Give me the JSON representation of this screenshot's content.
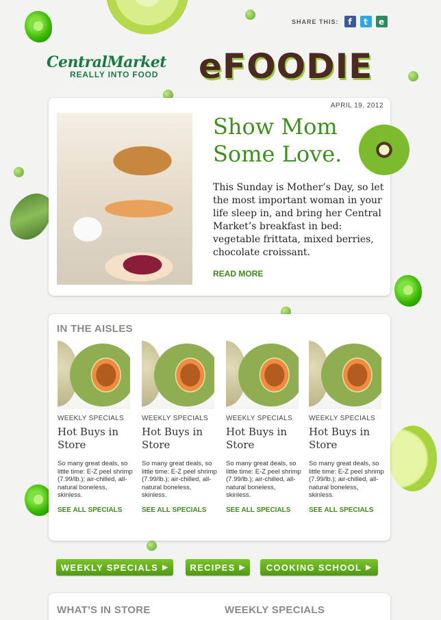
{
  "header": {
    "share_label": "SHARE THIS:",
    "share_icons": [
      "facebook-icon",
      "twitter-icon",
      "email-icon"
    ],
    "share_glyphs": {
      "facebook": "f",
      "twitter": "t",
      "email": "e"
    },
    "brand_name": "CentralMarket",
    "brand_tagline": "REALLY INTO FOOD",
    "newsletter_title": "eFOODIE"
  },
  "hero": {
    "date": "APRIL 19, 2012",
    "title": "Show Mom Some Love.",
    "body": "This Sunday is Mother’s Day, so let the most important woman in your life sleep in, and bring her Central Market’s breakfast in bed: vegetable frittata, mixed berries, chocolate croissant.",
    "link": "READ MORE"
  },
  "aisles": {
    "heading": "IN THE AISLES",
    "items": [
      {
        "kicker": "WEEKLY SPECIALS",
        "title": "Hot Buys in Store",
        "body": "So many great deals, so little time: E-Z peel shrimp (7.99/lb.); air-chilled, all-natural boneless, skinless.",
        "link": "SEE ALL SPECIALS"
      },
      {
        "kicker": "WEEKLY SPECIALS",
        "title": "Hot Buys in Store",
        "body": "So many great deals, so little time: E-Z peel shrimp (7.99/lb.); air-chilled, all-natural boneless, skinless.",
        "link": "SEE ALL SPECIALS"
      },
      {
        "kicker": "WEEKLY SPECIALS",
        "title": "Hot Buys in Store",
        "body": "So many great deals, so little time: E-Z peel shrimp (7.99/lb.); air-chilled, all-natural boneless, skinless.",
        "link": "SEE ALL SPECIALS"
      },
      {
        "kicker": "WEEKLY SPECIALS",
        "title": "Hot Buys in Store",
        "body": "So many great deals, so little time: E-Z peel shrimp (7.99/lb.); air-chilled, all-natural boneless, skinless.",
        "link": "SEE ALL SPECIALS"
      }
    ]
  },
  "nav": {
    "buttons": [
      "WEEKLY SPECIALS",
      "RECIPES",
      "COOKING SCHOOL"
    ],
    "arrow": "▶"
  },
  "bottom": {
    "left_heading": "WHAT'S IN STORE",
    "right_heading": "WEEKLY SPECIALS"
  },
  "colors": {
    "accent_green": "#3e8f1e",
    "button_green": "#5aa81a",
    "brand_brown": "#4a2a22"
  }
}
